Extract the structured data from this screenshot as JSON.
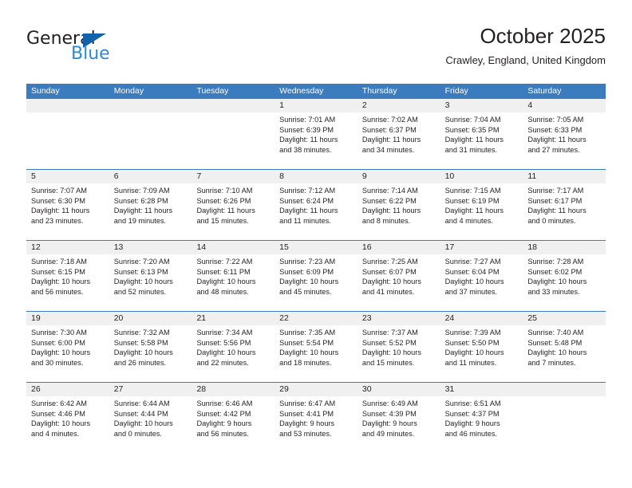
{
  "brand": {
    "name_part1": "General",
    "name_part2": "Blue",
    "triangle_color": "#1263ac",
    "blue_color": "#2d8ad6"
  },
  "header": {
    "title": "October 2025",
    "subtitle": "Crawley, England, United Kingdom"
  },
  "theme": {
    "header_row_bg": "#3a7cbe",
    "daynum_bg": "#f0f0f0",
    "text_color": "#231f20"
  },
  "weekdays": [
    "Sunday",
    "Monday",
    "Tuesday",
    "Wednesday",
    "Thursday",
    "Friday",
    "Saturday"
  ],
  "weeks": [
    [
      {
        "day": "",
        "empty": true
      },
      {
        "day": "",
        "empty": true
      },
      {
        "day": "",
        "empty": true
      },
      {
        "day": "1",
        "sunrise": "Sunrise: 7:01 AM",
        "sunset": "Sunset: 6:39 PM",
        "daylight1": "Daylight: 11 hours",
        "daylight2": "and 38 minutes."
      },
      {
        "day": "2",
        "sunrise": "Sunrise: 7:02 AM",
        "sunset": "Sunset: 6:37 PM",
        "daylight1": "Daylight: 11 hours",
        "daylight2": "and 34 minutes."
      },
      {
        "day": "3",
        "sunrise": "Sunrise: 7:04 AM",
        "sunset": "Sunset: 6:35 PM",
        "daylight1": "Daylight: 11 hours",
        "daylight2": "and 31 minutes."
      },
      {
        "day": "4",
        "sunrise": "Sunrise: 7:05 AM",
        "sunset": "Sunset: 6:33 PM",
        "daylight1": "Daylight: 11 hours",
        "daylight2": "and 27 minutes."
      }
    ],
    [
      {
        "day": "5",
        "sunrise": "Sunrise: 7:07 AM",
        "sunset": "Sunset: 6:30 PM",
        "daylight1": "Daylight: 11 hours",
        "daylight2": "and 23 minutes."
      },
      {
        "day": "6",
        "sunrise": "Sunrise: 7:09 AM",
        "sunset": "Sunset: 6:28 PM",
        "daylight1": "Daylight: 11 hours",
        "daylight2": "and 19 minutes."
      },
      {
        "day": "7",
        "sunrise": "Sunrise: 7:10 AM",
        "sunset": "Sunset: 6:26 PM",
        "daylight1": "Daylight: 11 hours",
        "daylight2": "and 15 minutes."
      },
      {
        "day": "8",
        "sunrise": "Sunrise: 7:12 AM",
        "sunset": "Sunset: 6:24 PM",
        "daylight1": "Daylight: 11 hours",
        "daylight2": "and 11 minutes."
      },
      {
        "day": "9",
        "sunrise": "Sunrise: 7:14 AM",
        "sunset": "Sunset: 6:22 PM",
        "daylight1": "Daylight: 11 hours",
        "daylight2": "and 8 minutes."
      },
      {
        "day": "10",
        "sunrise": "Sunrise: 7:15 AM",
        "sunset": "Sunset: 6:19 PM",
        "daylight1": "Daylight: 11 hours",
        "daylight2": "and 4 minutes."
      },
      {
        "day": "11",
        "sunrise": "Sunrise: 7:17 AM",
        "sunset": "Sunset: 6:17 PM",
        "daylight1": "Daylight: 11 hours",
        "daylight2": "and 0 minutes."
      }
    ],
    [
      {
        "day": "12",
        "sunrise": "Sunrise: 7:18 AM",
        "sunset": "Sunset: 6:15 PM",
        "daylight1": "Daylight: 10 hours",
        "daylight2": "and 56 minutes."
      },
      {
        "day": "13",
        "sunrise": "Sunrise: 7:20 AM",
        "sunset": "Sunset: 6:13 PM",
        "daylight1": "Daylight: 10 hours",
        "daylight2": "and 52 minutes."
      },
      {
        "day": "14",
        "sunrise": "Sunrise: 7:22 AM",
        "sunset": "Sunset: 6:11 PM",
        "daylight1": "Daylight: 10 hours",
        "daylight2": "and 48 minutes."
      },
      {
        "day": "15",
        "sunrise": "Sunrise: 7:23 AM",
        "sunset": "Sunset: 6:09 PM",
        "daylight1": "Daylight: 10 hours",
        "daylight2": "and 45 minutes."
      },
      {
        "day": "16",
        "sunrise": "Sunrise: 7:25 AM",
        "sunset": "Sunset: 6:07 PM",
        "daylight1": "Daylight: 10 hours",
        "daylight2": "and 41 minutes."
      },
      {
        "day": "17",
        "sunrise": "Sunrise: 7:27 AM",
        "sunset": "Sunset: 6:04 PM",
        "daylight1": "Daylight: 10 hours",
        "daylight2": "and 37 minutes."
      },
      {
        "day": "18",
        "sunrise": "Sunrise: 7:28 AM",
        "sunset": "Sunset: 6:02 PM",
        "daylight1": "Daylight: 10 hours",
        "daylight2": "and 33 minutes."
      }
    ],
    [
      {
        "day": "19",
        "sunrise": "Sunrise: 7:30 AM",
        "sunset": "Sunset: 6:00 PM",
        "daylight1": "Daylight: 10 hours",
        "daylight2": "and 30 minutes."
      },
      {
        "day": "20",
        "sunrise": "Sunrise: 7:32 AM",
        "sunset": "Sunset: 5:58 PM",
        "daylight1": "Daylight: 10 hours",
        "daylight2": "and 26 minutes."
      },
      {
        "day": "21",
        "sunrise": "Sunrise: 7:34 AM",
        "sunset": "Sunset: 5:56 PM",
        "daylight1": "Daylight: 10 hours",
        "daylight2": "and 22 minutes."
      },
      {
        "day": "22",
        "sunrise": "Sunrise: 7:35 AM",
        "sunset": "Sunset: 5:54 PM",
        "daylight1": "Daylight: 10 hours",
        "daylight2": "and 18 minutes."
      },
      {
        "day": "23",
        "sunrise": "Sunrise: 7:37 AM",
        "sunset": "Sunset: 5:52 PM",
        "daylight1": "Daylight: 10 hours",
        "daylight2": "and 15 minutes."
      },
      {
        "day": "24",
        "sunrise": "Sunrise: 7:39 AM",
        "sunset": "Sunset: 5:50 PM",
        "daylight1": "Daylight: 10 hours",
        "daylight2": "and 11 minutes."
      },
      {
        "day": "25",
        "sunrise": "Sunrise: 7:40 AM",
        "sunset": "Sunset: 5:48 PM",
        "daylight1": "Daylight: 10 hours",
        "daylight2": "and 7 minutes."
      }
    ],
    [
      {
        "day": "26",
        "sunrise": "Sunrise: 6:42 AM",
        "sunset": "Sunset: 4:46 PM",
        "daylight1": "Daylight: 10 hours",
        "daylight2": "and 4 minutes."
      },
      {
        "day": "27",
        "sunrise": "Sunrise: 6:44 AM",
        "sunset": "Sunset: 4:44 PM",
        "daylight1": "Daylight: 10 hours",
        "daylight2": "and 0 minutes."
      },
      {
        "day": "28",
        "sunrise": "Sunrise: 6:46 AM",
        "sunset": "Sunset: 4:42 PM",
        "daylight1": "Daylight: 9 hours",
        "daylight2": "and 56 minutes."
      },
      {
        "day": "29",
        "sunrise": "Sunrise: 6:47 AM",
        "sunset": "Sunset: 4:41 PM",
        "daylight1": "Daylight: 9 hours",
        "daylight2": "and 53 minutes."
      },
      {
        "day": "30",
        "sunrise": "Sunrise: 6:49 AM",
        "sunset": "Sunset: 4:39 PM",
        "daylight1": "Daylight: 9 hours",
        "daylight2": "and 49 minutes."
      },
      {
        "day": "31",
        "sunrise": "Sunrise: 6:51 AM",
        "sunset": "Sunset: 4:37 PM",
        "daylight1": "Daylight: 9 hours",
        "daylight2": "and 46 minutes."
      },
      {
        "day": "",
        "empty": true
      }
    ]
  ]
}
